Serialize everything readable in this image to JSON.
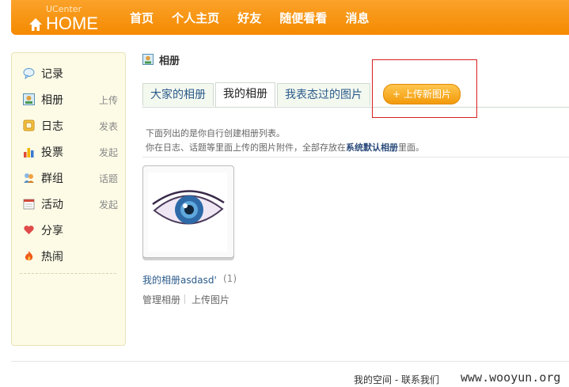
{
  "header": {
    "logo_small": "UCenter",
    "logo_big": "HOME",
    "nav": [
      "首页",
      "个人主页",
      "好友",
      "随便看看",
      "消息"
    ]
  },
  "sidebar": {
    "items": [
      {
        "label": "记录",
        "action": "",
        "icon": "speech-bubble-icon"
      },
      {
        "label": "相册",
        "action": "上传",
        "icon": "photo-icon"
      },
      {
        "label": "日志",
        "action": "发表",
        "icon": "notebook-icon"
      },
      {
        "label": "投票",
        "action": "发起",
        "icon": "bar-chart-icon"
      },
      {
        "label": "群组",
        "action": "话题",
        "icon": "group-icon"
      },
      {
        "label": "活动",
        "action": "发起",
        "icon": "calendar-icon"
      },
      {
        "label": "分享",
        "action": "",
        "icon": "heart-share-icon"
      },
      {
        "label": "热闹",
        "action": "",
        "icon": "fire-icon"
      }
    ]
  },
  "main": {
    "title": "相册",
    "tabs": [
      {
        "label": "大家的相册",
        "active": false
      },
      {
        "label": "我的相册",
        "active": true
      },
      {
        "label": "我表态过的图片",
        "active": false
      }
    ],
    "upload_button": "上传新图片",
    "desc_line1": "下面列出的是你自行创建相册列表。",
    "desc_line2_prefix": "你在日志、话题等里面上传的图片附件，全部存放在",
    "desc_line2_bold": "系统默认相册",
    "desc_line2_suffix": "里面。",
    "album": {
      "name": "我的相册asdasd'",
      "count": "(1)",
      "manage": "管理相册",
      "upload": "上传图片"
    }
  },
  "footer": {
    "links": "我的空间 - 联系我们",
    "watermark": "www.wooyun.org"
  },
  "colors": {
    "header_orange": "#f79300",
    "sidebar_bg": "#fdfbe6",
    "highlight_red": "#d71e1e",
    "link_blue": "#2a5a8a"
  }
}
